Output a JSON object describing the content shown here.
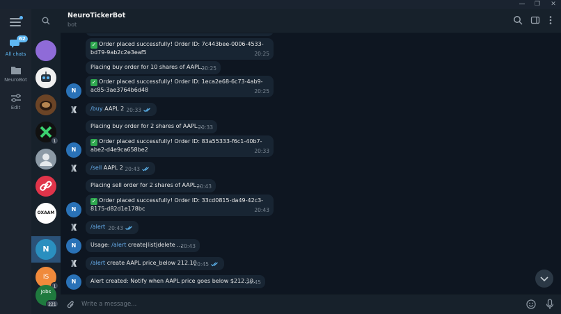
{
  "window": {
    "minimize": "—",
    "restore": "❐",
    "close": "✕"
  },
  "rail": {
    "folders": [
      {
        "label": "All chats",
        "badge": "62",
        "icon": "chats-icon"
      },
      {
        "label": "NeuroBot",
        "icon": "folder-icon"
      },
      {
        "label": "Edit",
        "icon": "sliders-icon"
      }
    ]
  },
  "chatlist": {
    "avatars": [
      {
        "name": "purple-avatar",
        "color": "#8f6bd8"
      },
      {
        "name": "robot-avatar",
        "color": "#f0f0f0"
      },
      {
        "name": "coffee-avatar",
        "color": "#5a3a22"
      },
      {
        "name": "x-logo-avatar",
        "color": "#111111",
        "unread": "1"
      },
      {
        "name": "person-avatar",
        "color": "#8c9aa6"
      },
      {
        "name": "link-avatar",
        "color": "#e0344a"
      },
      {
        "name": "oxaam-avatar",
        "color": "#ffffff",
        "text": "OXAAM"
      },
      {
        "name": "n-avatar",
        "color": "#2a8fbf",
        "text": "N"
      },
      {
        "name": "is-avatar",
        "color": "#f08a3b",
        "text": "IS",
        "unread": "1"
      },
      {
        "name": "jobs-avatar",
        "color": "#1f7a3e",
        "text": "Jobs",
        "unread": "221"
      }
    ]
  },
  "header": {
    "title": "NeuroTickerBot",
    "subtitle": "bot"
  },
  "messages": {
    "m1": {
      "text": "Order placed successfully! Order ID: 7c443bee-0006-4533-bd79-9ab2c2e3eaf5",
      "time": "20:25"
    },
    "m2": {
      "text": "Placing buy order for 10 shares of AAPL...",
      "time": "20:25"
    },
    "m3": {
      "text": "Order placed successfully! Order ID: 1eca2e68-6c73-4ab9-ac85-3ae3764b6d48",
      "time": "20:25"
    },
    "m4": {
      "cmd": "/buy",
      "text": " AAPL 2",
      "time": "20:33"
    },
    "m5": {
      "text": "Placing buy order for 2 shares of AAPL...",
      "time": "20:33"
    },
    "m6": {
      "text": "Order placed successfully! Order ID: 83a55333-f6c1-40b7-abe2-d4e9ca658be2",
      "time": "20:33"
    },
    "m7": {
      "cmd": "/sell",
      "text": " AAPL 2",
      "time": "20:43"
    },
    "m8": {
      "text": "Placing sell order for 2 shares of AAPL...",
      "time": "20:43"
    },
    "m9": {
      "text": "Order placed successfully! Order ID: 33cd0815-da49-42c3-8175-d82d1e178bc",
      "time": "20:43"
    },
    "m10": {
      "cmd": "/alert",
      "time": "20:43"
    },
    "m11": {
      "prefix": "Usage: ",
      "cmd": "/alert",
      "text": " create|list|delete ...",
      "time": "20:43"
    },
    "m12": {
      "cmd": "/alert",
      "text": " create AAPL price_below 212.10",
      "time": "20:45"
    },
    "m13": {
      "text": "Alert created: Notify when AAPL price goes below $212.10.",
      "time": "20:45"
    }
  },
  "bot_avatar_letter": "N",
  "input": {
    "placeholder": "Write a message..."
  },
  "colors": {
    "accent": "#5fb8f3",
    "bubble": "#182533",
    "background": "#0e1621",
    "check": "#2fa84f"
  }
}
